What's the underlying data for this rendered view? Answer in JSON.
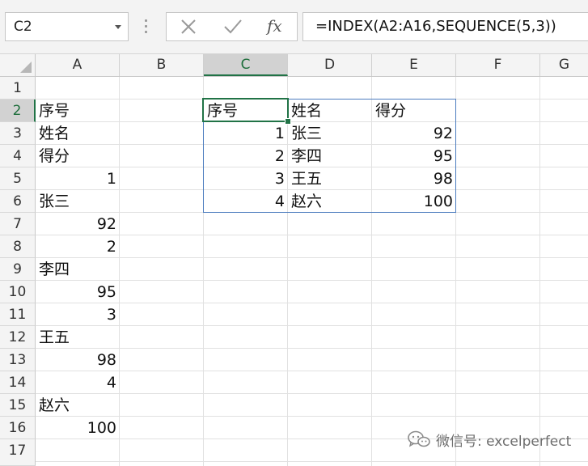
{
  "name_box": {
    "value": "C2"
  },
  "formula_bar": {
    "cancel_icon": "x-icon",
    "enter_icon": "check-icon",
    "fx_label": "fx",
    "formula": "=INDEX(A2:A16,SEQUENCE(5,3))"
  },
  "columns": [
    "A",
    "B",
    "C",
    "D",
    "E",
    "F",
    "G"
  ],
  "rows": [
    "1",
    "2",
    "3",
    "4",
    "5",
    "6",
    "7",
    "8",
    "9",
    "10",
    "11",
    "12",
    "13",
    "14",
    "15",
    "16",
    "17"
  ],
  "selected": {
    "column": "C",
    "row": "2"
  },
  "cells": {
    "A2": "序号",
    "A3": "姓名",
    "A4": "得分",
    "A5": "1",
    "A6": "张三",
    "A7": "92",
    "A8": "2",
    "A9": "李四",
    "A10": "95",
    "A11": "3",
    "A12": "王五",
    "A13": "98",
    "A14": "4",
    "A15": "赵六",
    "A16": "100",
    "C2": "序号",
    "D2": "姓名",
    "E2": "得分",
    "C3": "1",
    "D3": "张三",
    "E3": "92",
    "C4": "2",
    "D4": "李四",
    "E4": "95",
    "C5": "3",
    "D5": "王五",
    "E5": "98",
    "C6": "4",
    "D6": "赵六",
    "E6": "100"
  },
  "watermark": {
    "icon": "wechat-icon",
    "label": "微信号: excelperfect"
  }
}
